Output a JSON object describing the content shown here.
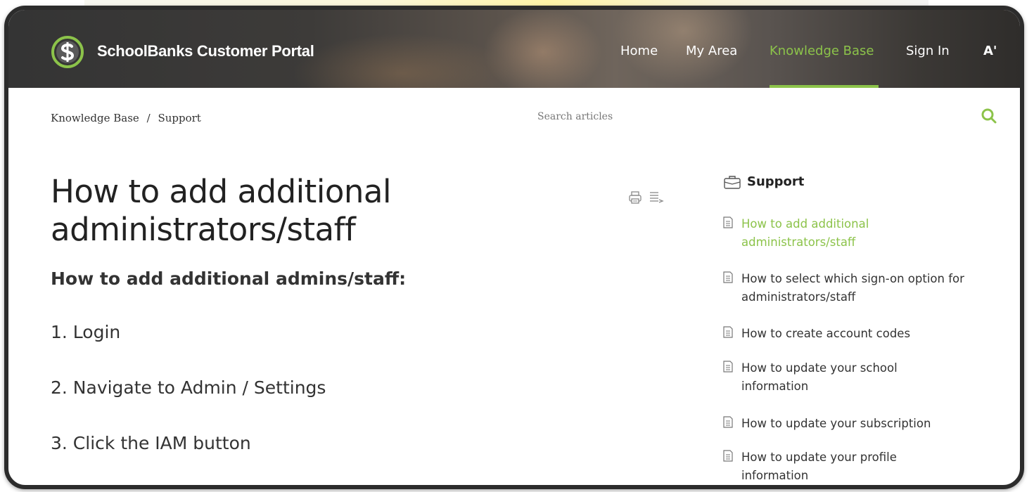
{
  "header": {
    "brand": "SchoolBanks Customer Portal",
    "nav": [
      "Home",
      "My Area",
      "Knowledge Base",
      "Sign In",
      "A'"
    ],
    "active_nav": "Knowledge Base",
    "accent": "#8cc34a"
  },
  "breadcrumb": {
    "root": "Knowledge Base",
    "separator": "/",
    "current": "Support"
  },
  "search": {
    "placeholder": "Search articles",
    "icon": "search-icon"
  },
  "article": {
    "title": "How to add additional administrators/staff",
    "subheading": "How to add additional admins/staff:",
    "steps": [
      "1. Login",
      "2. Navigate to Admin / Settings",
      "3. Click the IAM button"
    ],
    "tool_icons": [
      "print-icon",
      "text-size-icon"
    ]
  },
  "sidebar": {
    "category": "Support",
    "category_icon": "briefcase-icon",
    "articles": [
      "How to add additional administrators/staff",
      "How to select which sign-on option for administrators/staff",
      "How to create account codes",
      "How to update your school information",
      "How to update your subscription",
      "How to update your profile information"
    ],
    "active_index": 0
  }
}
